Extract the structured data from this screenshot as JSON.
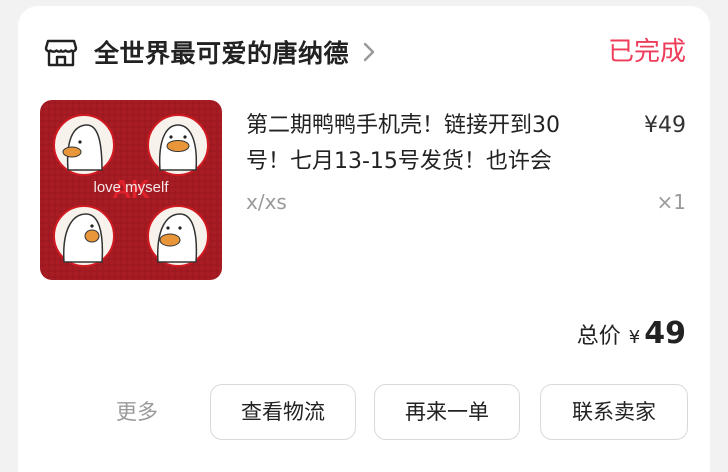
{
  "shop": {
    "name": "全世界最可爱的唐纳德",
    "icon": "store-icon"
  },
  "order": {
    "status": "已完成"
  },
  "product": {
    "image_caption": "love myself",
    "image_mark": "AK",
    "title_line1": "第二期鸭鸭手机壳！链接开到30",
    "title_line2": "号！七月13-15号发货！也许会",
    "price": "¥49",
    "spec": "x/xs",
    "quantity": "×1"
  },
  "total": {
    "label": "总价",
    "currency": "¥",
    "amount": "49"
  },
  "actions": {
    "more": "更多",
    "logistics": "查看物流",
    "reorder": "再来一单",
    "contact": "联系卖家"
  },
  "colors": {
    "status": "#ee3d5a",
    "image_background": "#a81c24"
  }
}
